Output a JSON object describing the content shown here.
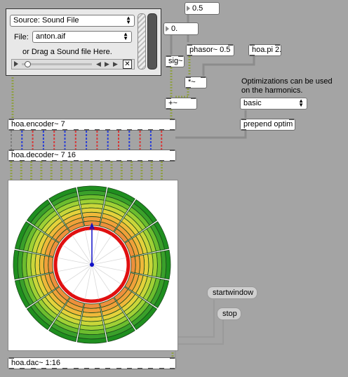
{
  "player": {
    "source_label": "Source: Sound File",
    "file_label": "File:",
    "file_value": "anton.aif",
    "drag_hint": "or Drag a Sound file Here."
  },
  "numbers": {
    "top_number": "0.5",
    "phase_number": "0."
  },
  "objects": {
    "sig": "sig~",
    "phasor": "phasor~ 0.5",
    "hoapi": "hoa.pi 2.",
    "mult": "*~",
    "plus": "+~",
    "encoder": "hoa.encoder~ 7",
    "decoder": "hoa.decoder~ 7 16",
    "dac": "hoa.dac~ 1:16",
    "prepend": "prepend optim"
  },
  "comment": {
    "optim_line1": "Optimizations can be used",
    "optim_line2": "on the harmonics."
  },
  "optim_menu": {
    "value": "basic"
  },
  "messages": {
    "startwindow": "startwindow",
    "stop": "stop"
  },
  "meter": {
    "channels": 16,
    "ring_colors": [
      "#1f8f1f",
      "#3aa02a",
      "#6cbd2e",
      "#9fd035",
      "#c9d63a",
      "#e4d13b",
      "#efb83a",
      "#f0a03a",
      "#ee8f3c"
    ],
    "peak_color": "#e01010",
    "vector_color": "#1010c8"
  },
  "colors": {
    "patch_cord_signal": "#a0b04a",
    "cord_blue": "#2a3fd6",
    "cord_red": "#d63a3a",
    "cord_gray": "#808080"
  }
}
